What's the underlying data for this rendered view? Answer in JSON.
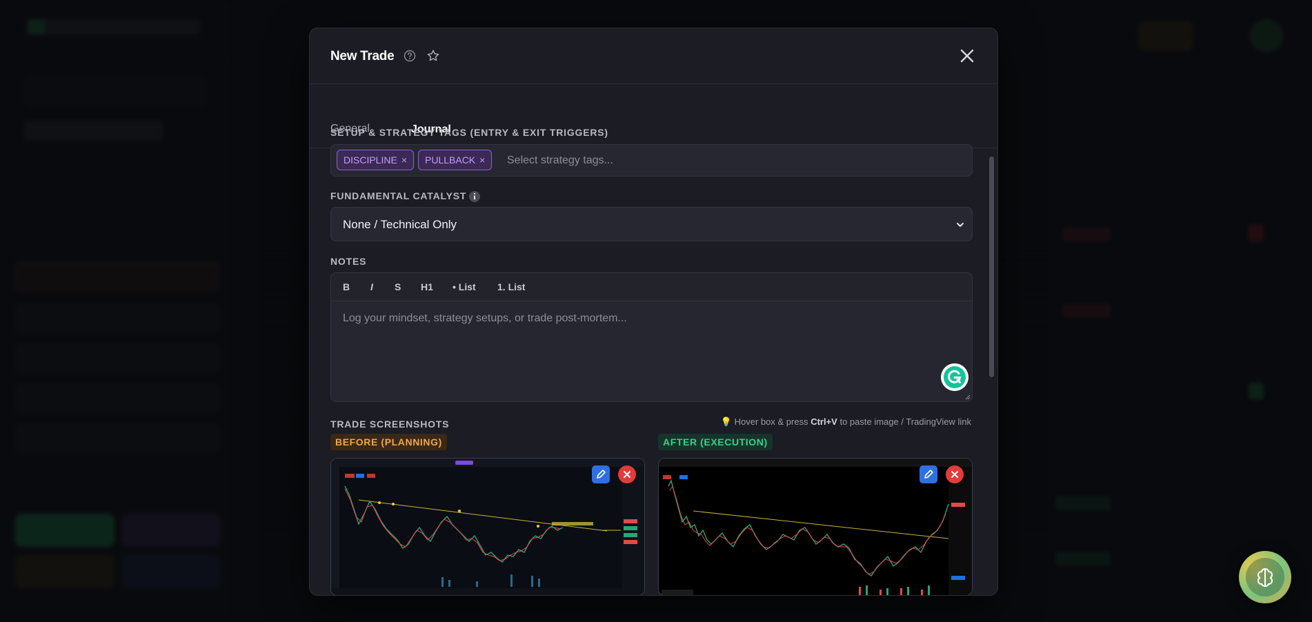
{
  "modal": {
    "title": "New Trade",
    "tabs": [
      {
        "label": "General",
        "active": false
      },
      {
        "label": "Journal",
        "active": true
      }
    ]
  },
  "strategy": {
    "label": "SETUP & STRATEGY TAGS (ENTRY & EXIT TRIGGERS)",
    "tags": [
      "DISCIPLINE",
      "PULLBACK"
    ],
    "remove_glyph": "×",
    "placeholder": "Select strategy tags..."
  },
  "catalyst": {
    "label": "FUNDAMENTAL CATALYST",
    "selected": "None / Technical Only"
  },
  "notes": {
    "label": "NOTES",
    "toolbar": [
      "B",
      "I",
      "S",
      "H1",
      "• List",
      "1. List"
    ],
    "placeholder": "Log your mindset, strategy setups, or trade post-mortem..."
  },
  "screenshots": {
    "label": "TRADE SCREENSHOTS",
    "hint_prefix": "💡 Hover box & press ",
    "hint_key": "Ctrl+V",
    "hint_suffix": " to paste image / TradingView link",
    "before_label": "BEFORE (PLANNING)",
    "after_label": "AFTER (EXECUTION)"
  },
  "colors": {
    "accent": "#f08a2c",
    "tag_purple": "#8f5fd6",
    "before_orange": "#f0a64a",
    "after_green": "#37d08c"
  },
  "icons": {
    "help": "help-circle-icon",
    "star": "star-icon",
    "close": "close-icon",
    "info": "info-icon",
    "edit": "pencil-icon",
    "delete": "close-circle-icon",
    "grammarly": "grammarly-icon",
    "ai": "brain-icon"
  }
}
